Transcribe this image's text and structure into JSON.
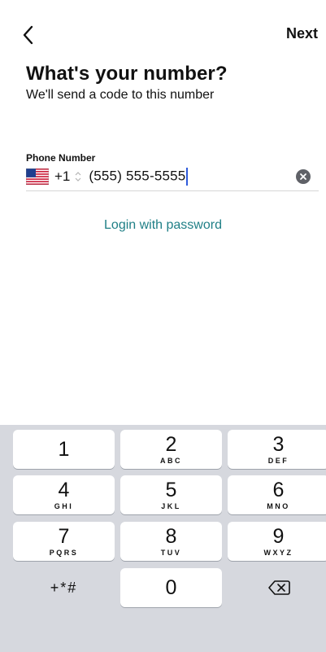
{
  "nav": {
    "back_icon": "chevron-left-icon",
    "next_label": "Next"
  },
  "header": {
    "title": "What's your number?",
    "subtitle": "We'll send a code to this number"
  },
  "phone_field": {
    "label": "Phone Number",
    "country_flag_icon": "us-flag-icon",
    "country_code": "+1",
    "value": "(555) 555-5555",
    "clear_icon": "clear-icon"
  },
  "login_with_password": "Login with password",
  "keypad": {
    "keys": [
      {
        "digit": "1",
        "letters": ""
      },
      {
        "digit": "2",
        "letters": "ABC"
      },
      {
        "digit": "3",
        "letters": "DEF"
      },
      {
        "digit": "4",
        "letters": "GHI"
      },
      {
        "digit": "5",
        "letters": "JKL"
      },
      {
        "digit": "6",
        "letters": "MNO"
      },
      {
        "digit": "7",
        "letters": "PQRS"
      },
      {
        "digit": "8",
        "letters": "TUV"
      },
      {
        "digit": "9",
        "letters": "WXYZ"
      },
      {
        "digit": "+*#",
        "letters": ""
      },
      {
        "digit": "0",
        "letters": ""
      },
      {
        "digit": "",
        "letters": ""
      }
    ],
    "delete_icon": "delete-icon"
  },
  "colors": {
    "link": "#1f7f86",
    "caret": "#2f5bdb",
    "keypad_bg": "#d6d8de"
  }
}
